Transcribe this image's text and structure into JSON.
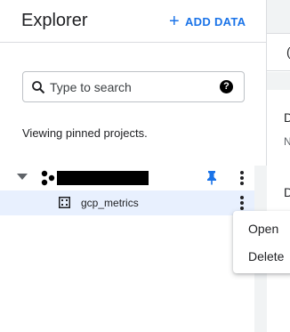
{
  "explorer": {
    "title": "Explorer",
    "add_data_label": "ADD DATA",
    "search": {
      "placeholder": "Type to search",
      "value": ""
    },
    "pinned_text": "Viewing pinned projects.",
    "project": {
      "name": ""
    },
    "dataset": {
      "name": "gcp_metrics"
    }
  },
  "right_panel": {
    "tab_label_fragment": "(",
    "heading_fragment_1": "D",
    "subtext_fragment": "N",
    "heading_fragment_2": "D"
  },
  "context_menu": {
    "items": [
      {
        "label": "Open"
      },
      {
        "label": "Delete"
      }
    ]
  },
  "colors": {
    "accent": "#1a73e8",
    "selected_row": "#e8f0fe",
    "divider": "#dadce0"
  }
}
